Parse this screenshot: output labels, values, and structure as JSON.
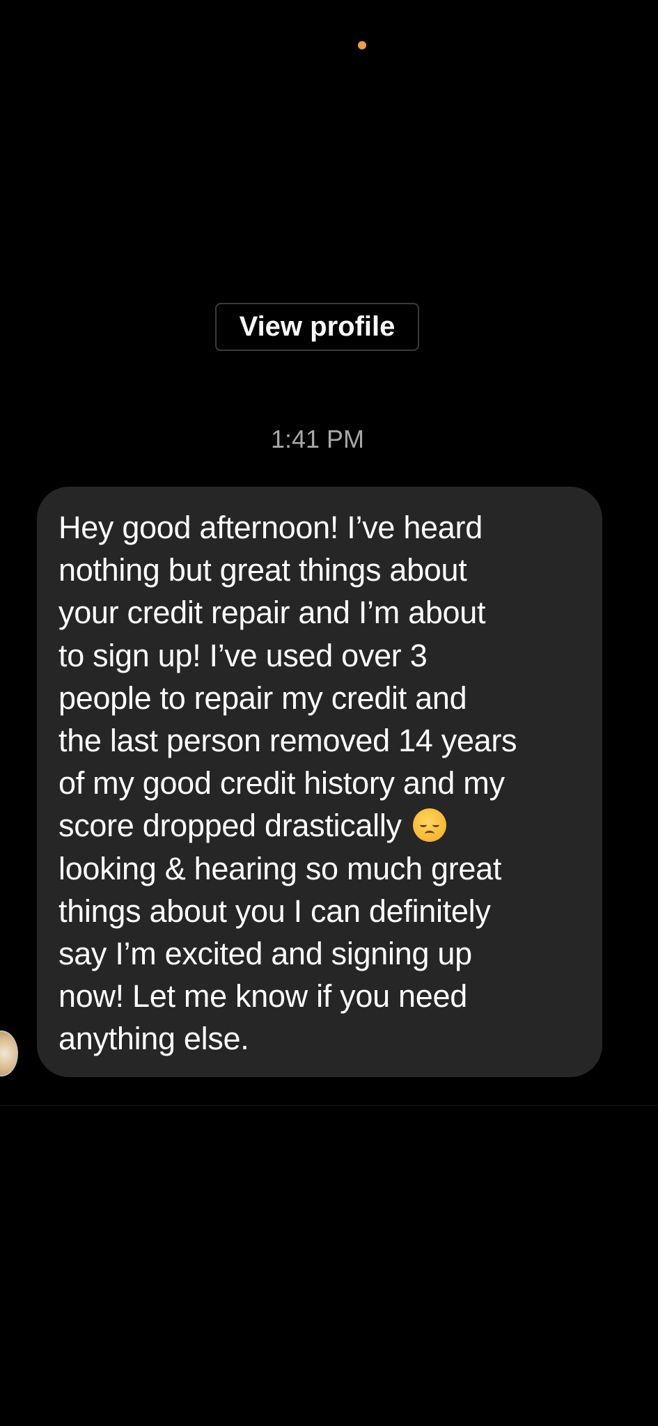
{
  "header": {
    "status_dot_color": "#f2994a"
  },
  "profile": {
    "view_profile_label": "View profile"
  },
  "conversation": {
    "timestamp": "1:41 PM",
    "message": {
      "text_before_emoji": "Hey good afternoon! I’ve heard\nnothing but great things about\nyour credit repair and I’m about\nto sign up! I’ve used over 3\npeople to repair my credit and\nthe last person removed 14 years\nof my good credit history and my\nscore dropped drastically ",
      "emoji_icon": "disappointed-face-emoji",
      "text_after_emoji": "\nlooking & hearing so much great\nthings about you I can definitely\nsay I’m excited and signing up\nnow! Let me know if you need\nanything else.",
      "bubble_color": "#262626"
    },
    "sender_avatar_icon": "avatar-photo"
  }
}
